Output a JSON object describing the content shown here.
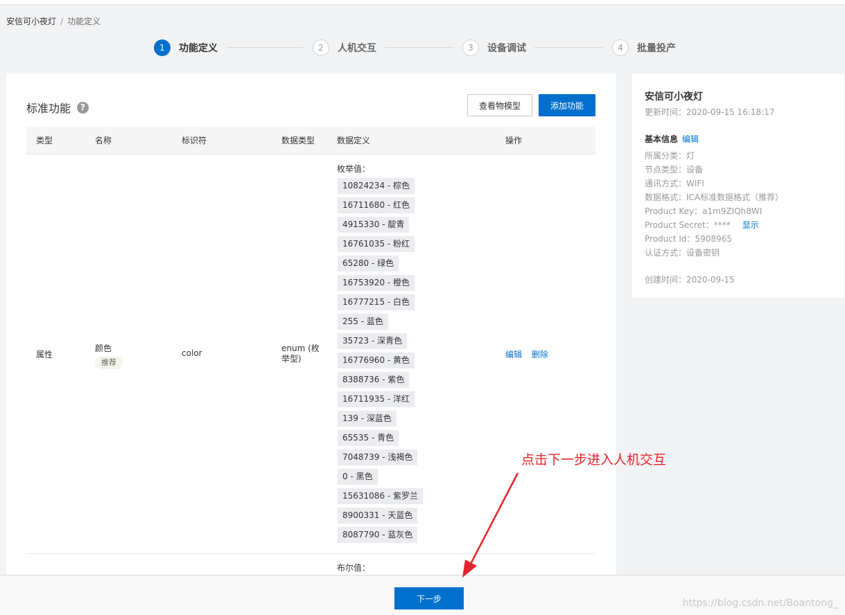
{
  "breadcrumb": {
    "product": "安信可小夜灯",
    "current": "功能定义",
    "sep": "/"
  },
  "steps": [
    {
      "num": "1",
      "label": "功能定义"
    },
    {
      "num": "2",
      "label": "人机交互"
    },
    {
      "num": "3",
      "label": "设备调试"
    },
    {
      "num": "4",
      "label": "批量投产"
    }
  ],
  "panel": {
    "title": "标准功能",
    "help": "?",
    "view_model_label": "查看物模型",
    "add_function_label": "添加功能"
  },
  "table": {
    "headers": {
      "type": "类型",
      "name": "名称",
      "identifier": "标识符",
      "data_type": "数据类型",
      "data_def": "数据定义",
      "actions": "操作"
    },
    "row1": {
      "type": "属性",
      "name": "颜色",
      "tag": "推荐",
      "identifier": "color",
      "data_type": "enum (枚举型)",
      "enum_title": "枚举值：",
      "enum_values": [
        "10824234 - 棕色",
        "16711680 - 红色",
        "4915330 - 靛青",
        "16761035 - 粉红",
        "65280 - 绿色",
        "16753920 - 橙色",
        "16777215 - 白色",
        "255 - 蓝色",
        "35723 - 深青色",
        "16776960 - 黄色",
        "8388736 - 紫色",
        "16711935 - 洋红",
        "139 - 深蓝色",
        "65535 - 青色",
        "7048739 - 浅褐色",
        "0 - 黑色",
        "15631086 - 紫罗兰",
        "8900331 - 天蓝色",
        "8087790 - 蓝灰色"
      ],
      "edit": "编辑",
      "delete": "删除"
    },
    "row2": {
      "def_title": "布尔值："
    }
  },
  "info": {
    "name": "安信可小夜灯",
    "updated": "更新时间：2020-09-15 16:18:17",
    "basic_title": "基本信息",
    "basic_edit": "编辑",
    "category": "所属分类：灯",
    "node_type": "节点类型：设备",
    "comm": "通讯方式：WIFI",
    "data_format": "数据格式：ICA标准数据格式（推荐）",
    "product_key": "Product Key：a1m9ZIQh8WI",
    "product_secret": "Product Secret：****",
    "show": "显示",
    "product_id": "Product Id：5908965",
    "auth": "认证方式：设备密钥",
    "created": "创建时间：2020-09-15"
  },
  "footer": {
    "next_label": "下一步",
    "watermark": "https://blog.csdn.net/Boantong_"
  },
  "annotation": "点击下一步进入人机交互",
  "colors": {
    "primary": "#0070cc",
    "annotation": "#e8222b"
  }
}
